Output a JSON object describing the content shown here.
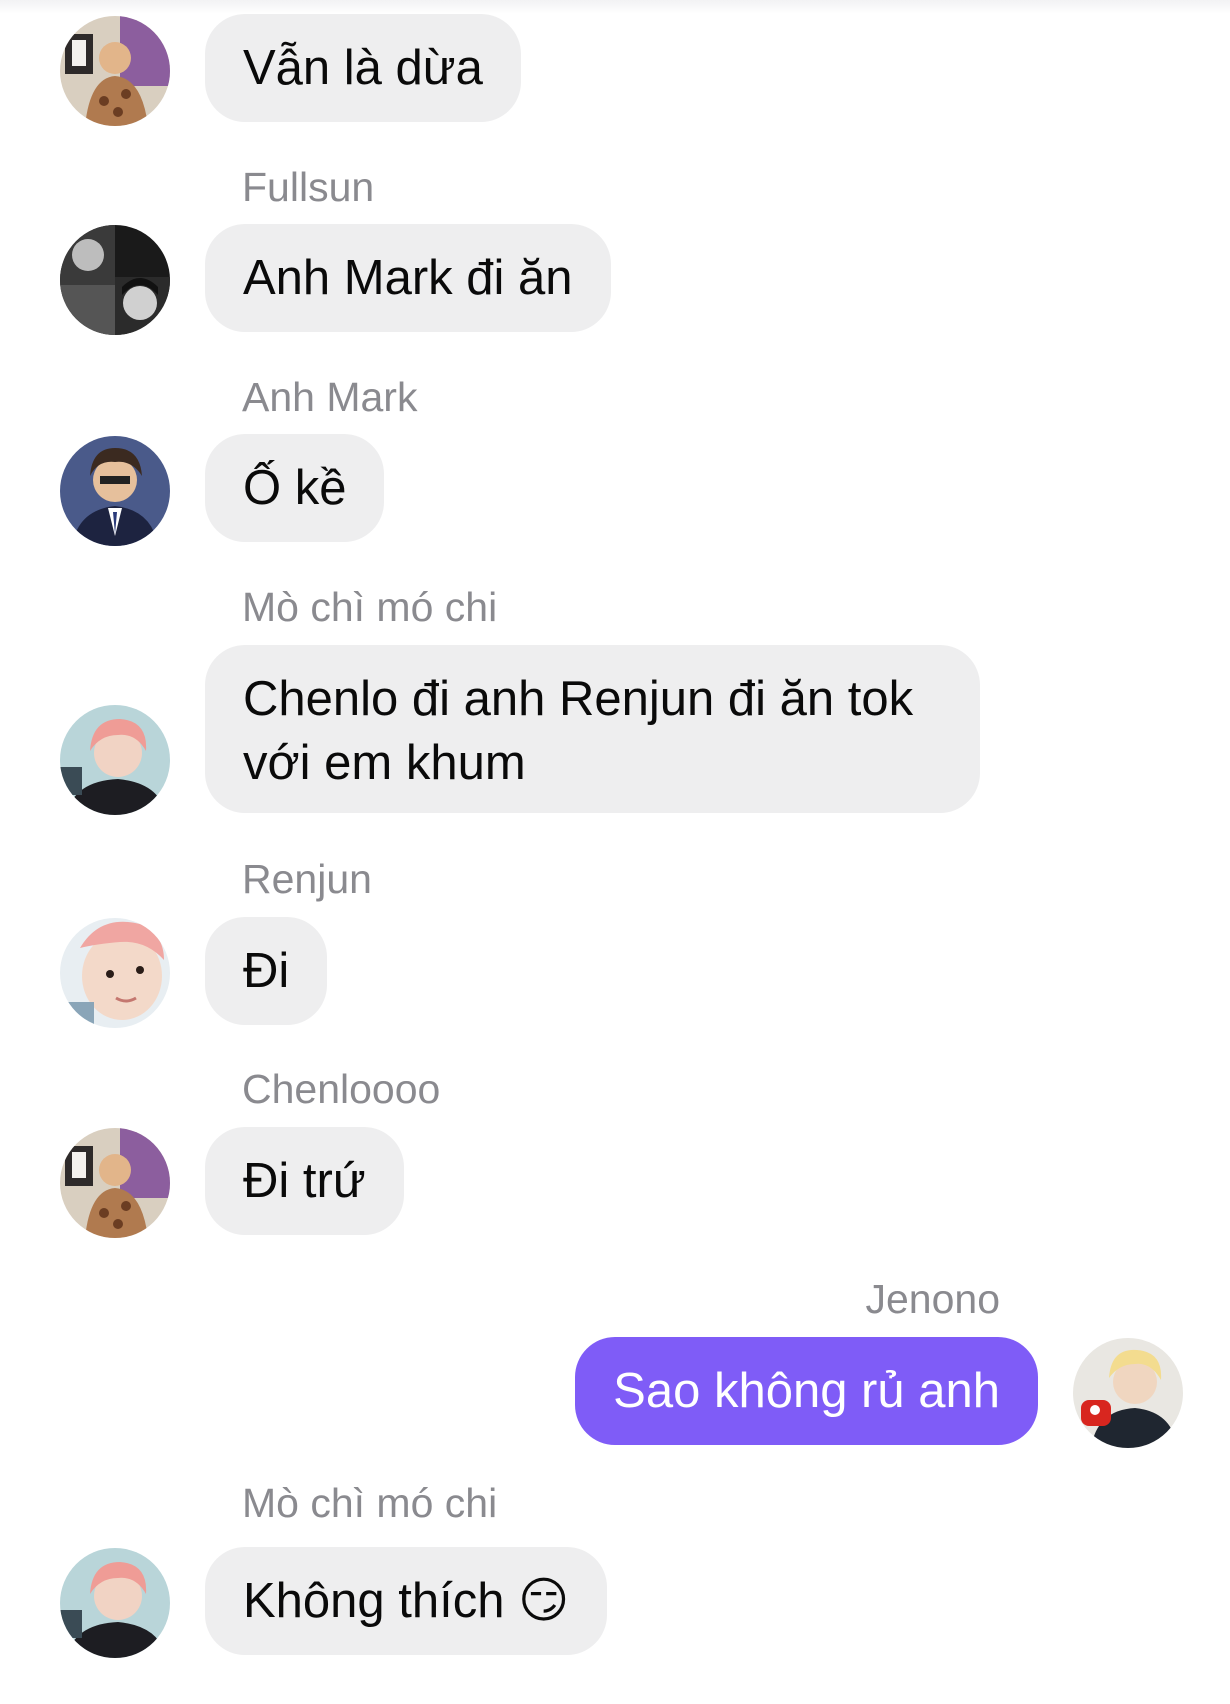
{
  "conversation": {
    "messages": [
      {
        "sender": "",
        "text": "Vẫn là dừa",
        "direction": "incoming",
        "avatar": "avatar-photo-stage"
      },
      {
        "sender": "Fullsun",
        "text": "Anh Mark đi ăn",
        "direction": "incoming",
        "avatar": "avatar-photo-bw"
      },
      {
        "sender": "Anh Mark",
        "text": "Ố kề",
        "direction": "incoming",
        "avatar": "avatar-photo-suit"
      },
      {
        "sender": "Mò chì mó chi",
        "text": "Chenlo đi anh Renjun đi ăn tok với em khum",
        "direction": "incoming",
        "avatar": "avatar-photo-pink-hair"
      },
      {
        "sender": "Renjun",
        "text": "Đi",
        "direction": "incoming",
        "avatar": "avatar-photo-closeup"
      },
      {
        "sender": "Chenloooo",
        "text": "Đi trứ",
        "direction": "incoming",
        "avatar": "avatar-photo-stage"
      },
      {
        "sender": "Jenono",
        "text": "Sao không rủ anh",
        "direction": "outgoing",
        "avatar": "avatar-photo-blond"
      },
      {
        "sender": "Mò chì mó chi",
        "text": "Không thích 😏",
        "direction": "incoming",
        "avatar": "avatar-photo-pink-hair"
      }
    ]
  },
  "colors": {
    "incoming_bubble": "#eeeeef",
    "outgoing_bubble": "#7f5cf7",
    "sender_name": "#8a8a8f",
    "background": "#ffffff"
  }
}
